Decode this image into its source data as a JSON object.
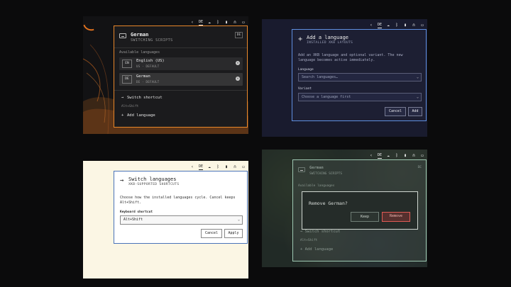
{
  "topbar": {
    "icons": [
      "chevron-left-icon",
      "keyboard-layout-indicator",
      "cloud-icon",
      "bluetooth-icon",
      "battery-icon",
      "headphones-icon",
      "chat-icon"
    ],
    "layout_code": "DE"
  },
  "panel": {
    "title": "German",
    "subtitle": "SWITCHING SCRIPTS",
    "badge": "DE",
    "section_label": "Available languages",
    "languages": [
      {
        "code": "EN",
        "name": "English (US)",
        "variant": "US · DEFAULT"
      },
      {
        "code": "DE",
        "name": "German",
        "variant": "DE · DEFAULT"
      }
    ],
    "switch_shortcut": "Switch shortcut",
    "shortcut_value": "Alt+Shift",
    "add_language": "Add language"
  },
  "add_dialog": {
    "title": "Add a language",
    "subtitle": "INSTALLED XKB LAYOUTS",
    "description": "Add an XKB language and optional variant. The new language becomes active immediately.",
    "language_label": "Language",
    "language_placeholder": "Search languages…",
    "variant_label": "Variant",
    "variant_placeholder": "Choose a language first",
    "cancel": "Cancel",
    "add": "Add"
  },
  "switch_dialog": {
    "title": "Switch languages",
    "subtitle": "XKB-SUPPORTED SHORTCUTS",
    "description": "Choose how the installed languages cycle. Cancel keeps Alt+Shift.",
    "shortcut_label": "Keyboard shortcut",
    "shortcut_value": "Alt+Shift",
    "cancel": "Cancel",
    "apply": "Apply"
  },
  "remove_dialog": {
    "title": "Remove German?",
    "keep": "Keep",
    "remove": "Remove"
  },
  "colors": {
    "accent_orange": "#e8872a",
    "accent_blue": "#5f8fe0",
    "accent_mint": "#9ec8b2",
    "danger": "#e05a55"
  }
}
